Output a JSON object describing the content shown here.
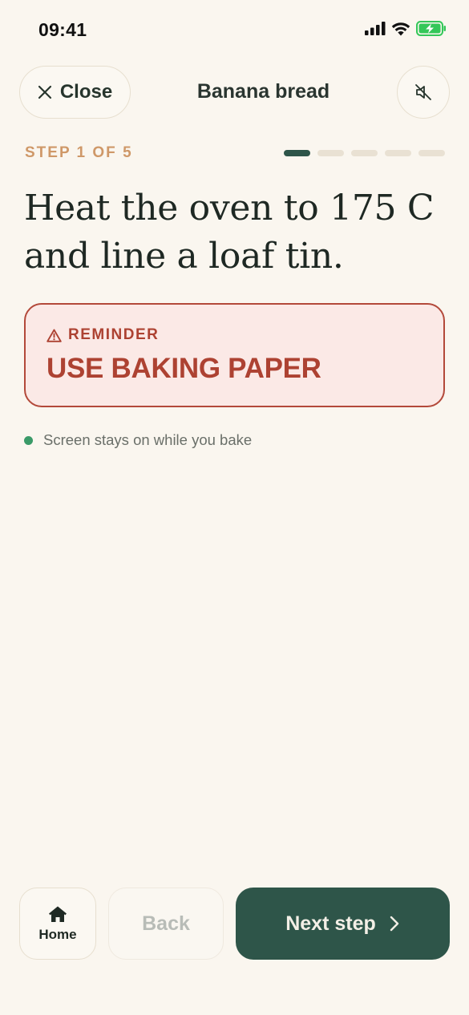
{
  "status_bar": {
    "time": "09:41",
    "icons": [
      "signal-icon",
      "wifi-icon",
      "battery-charging-icon"
    ],
    "battery_color": "#34c759"
  },
  "header": {
    "close_label": "Close",
    "close_icon": "close-icon",
    "title": "Banana bread",
    "mute_icon": "speaker-muted-icon"
  },
  "step": {
    "label": "STEP 1 OF 5",
    "current": 1,
    "total": 5
  },
  "instruction": {
    "line1": "Heat the oven to 175 C",
    "line2": "and line a loaf tin."
  },
  "reminder": {
    "icon": "warning-icon",
    "label": "REMINDER",
    "text": "USE BAKING PAPER"
  },
  "screen_note": {
    "text": "Screen stays on while you bake",
    "dot_color": "#3a9a68"
  },
  "bottom_bar": {
    "home_label": "Home",
    "home_icon": "home-icon",
    "back_label": "Back",
    "back_disabled": true,
    "next_label": "Next step",
    "next_icon": "chevron-right-icon"
  },
  "colors": {
    "background": "#faf6ef",
    "accent": "#2e5549",
    "step_label": "#cf9868",
    "reminder_text": "#ad4232",
    "reminder_border": "#b3493a",
    "reminder_bg": "#fbe9e6"
  }
}
